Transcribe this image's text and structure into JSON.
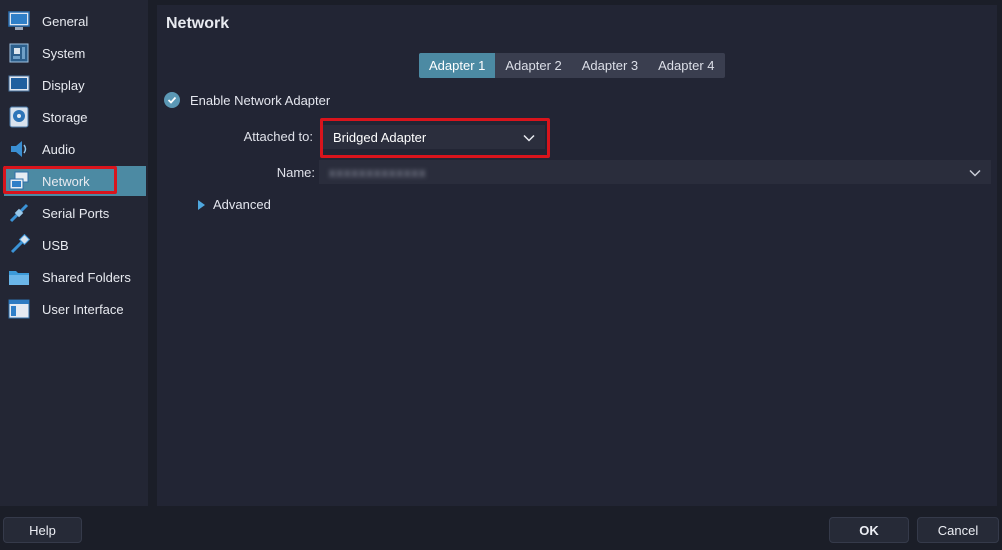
{
  "sidebar": {
    "items": [
      {
        "label": "General",
        "icon": "monitor-icon"
      },
      {
        "label": "System",
        "icon": "motherboard-icon"
      },
      {
        "label": "Display",
        "icon": "display-icon"
      },
      {
        "label": "Storage",
        "icon": "disk-icon"
      },
      {
        "label": "Audio",
        "icon": "speaker-icon"
      },
      {
        "label": "Network",
        "icon": "network-icon",
        "active": true
      },
      {
        "label": "Serial Ports",
        "icon": "serial-port-icon"
      },
      {
        "label": "USB",
        "icon": "usb-icon"
      },
      {
        "label": "Shared Folders",
        "icon": "folder-icon"
      },
      {
        "label": "User Interface",
        "icon": "window-icon"
      }
    ]
  },
  "main": {
    "title": "Network",
    "tabs": [
      {
        "label": "Adapter 1",
        "active": true
      },
      {
        "label": "Adapter 2"
      },
      {
        "label": "Adapter 3"
      },
      {
        "label": "Adapter 4"
      }
    ],
    "enable_label": "Enable Network Adapter",
    "enable_checked": true,
    "attached_label": "Attached to:",
    "attached_value": "Bridged Adapter",
    "name_label": "Name:",
    "name_value": "xxxxxxxxxxxxx",
    "advanced_label": "Advanced"
  },
  "footer": {
    "help": "Help",
    "ok": "OK",
    "cancel": "Cancel"
  },
  "colors": {
    "accent": "#4c8aa3",
    "highlight": "#d9141c"
  }
}
